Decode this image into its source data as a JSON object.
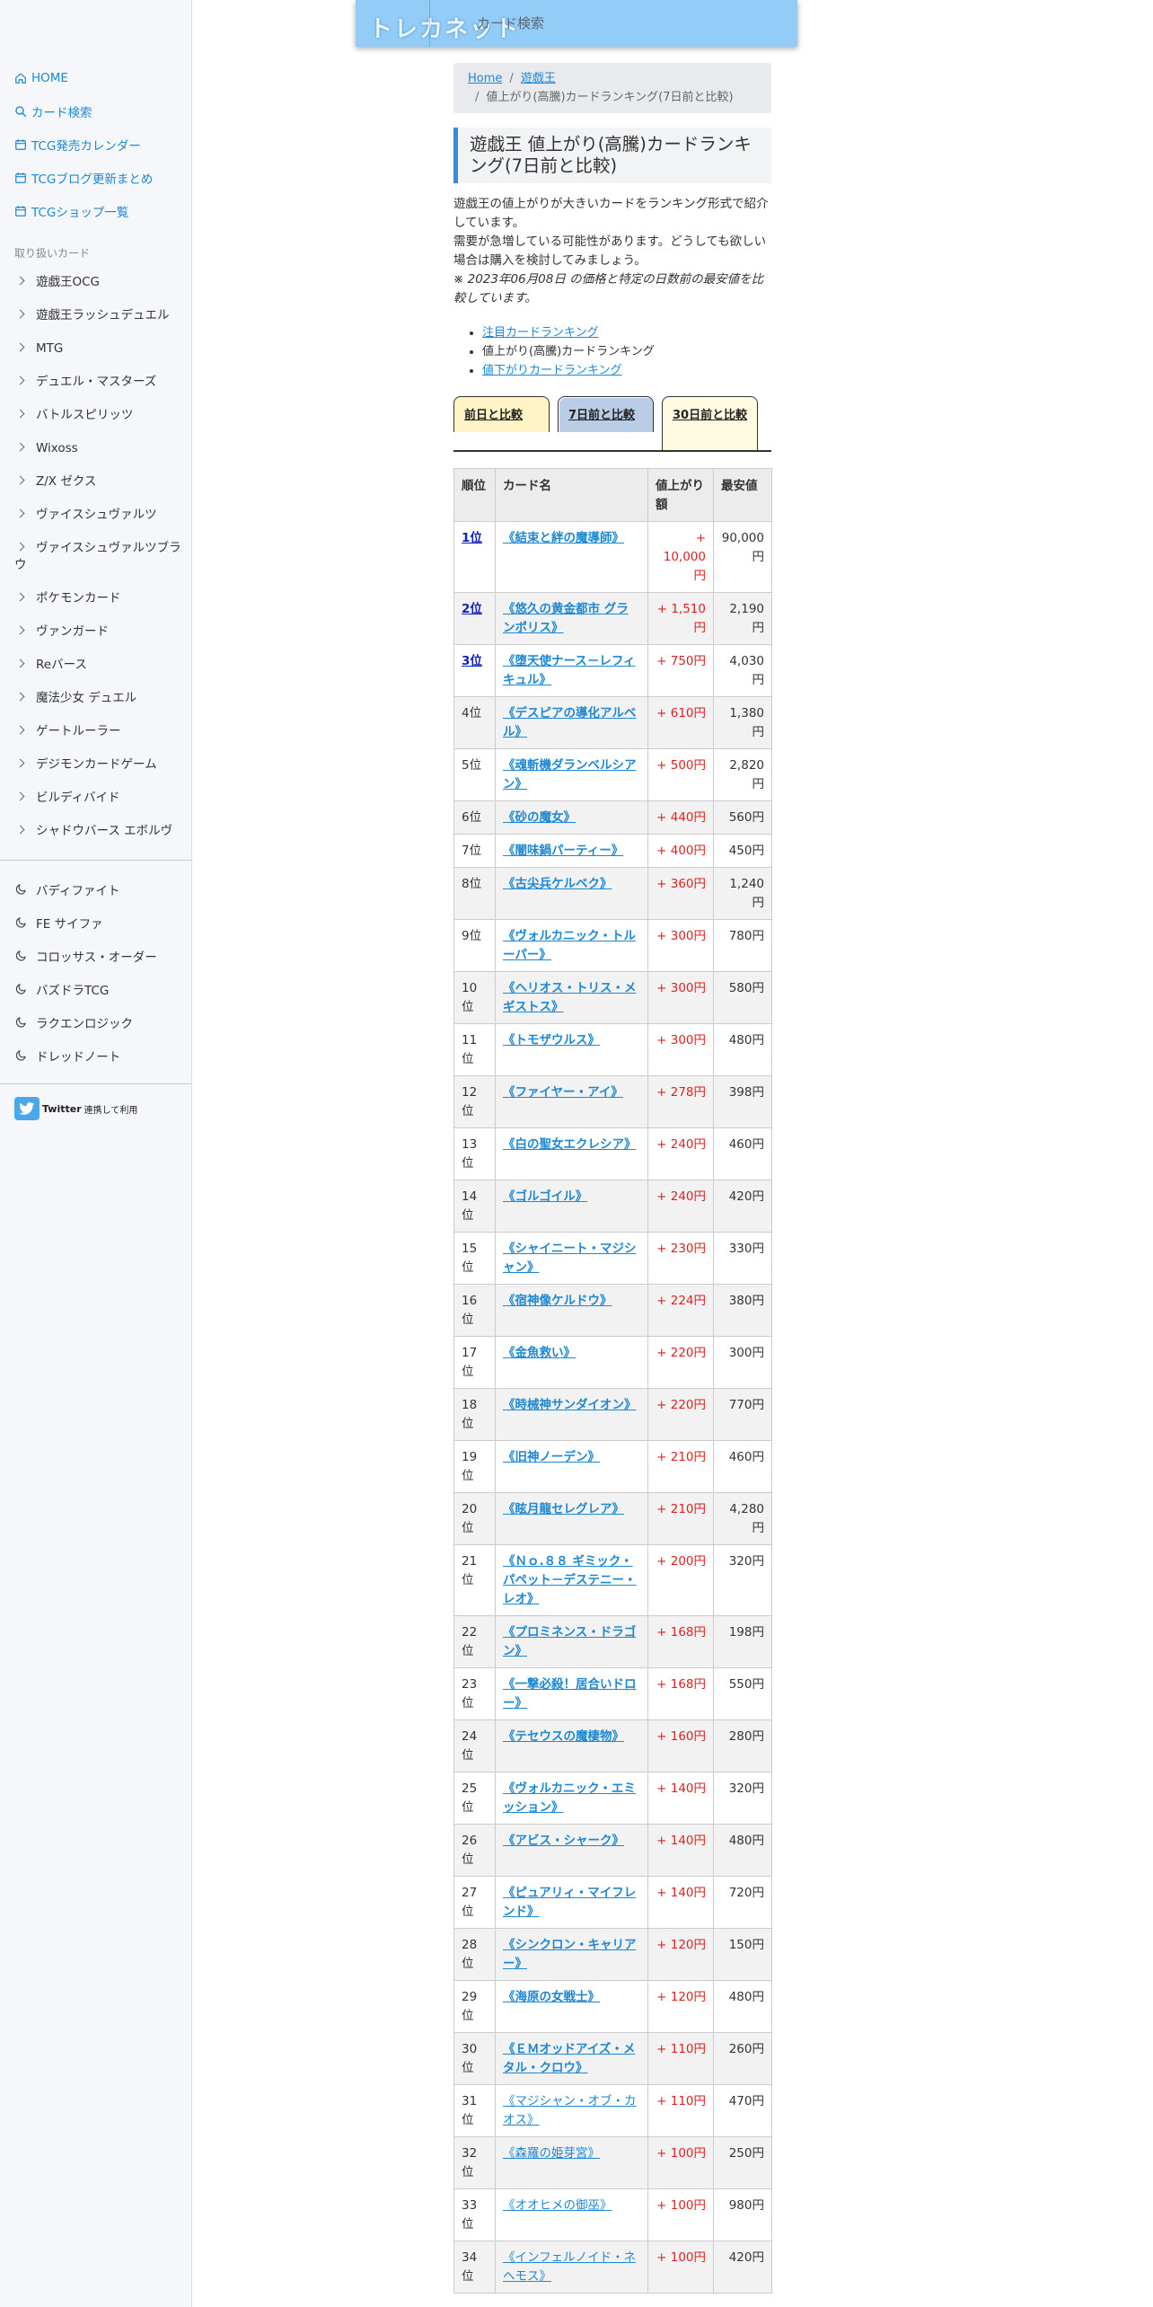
{
  "header": {
    "logo": "トレカネット",
    "search_placeholder": "カード検索"
  },
  "sidebar": {
    "nav": [
      {
        "label": "HOME",
        "icon": "home-icon"
      },
      {
        "label": "カード検索",
        "icon": "search-icon"
      },
      {
        "label": "TCG発売カレンダー",
        "icon": "calendar-icon"
      },
      {
        "label": "TCGブログ更新まとめ",
        "icon": "calendar-icon"
      },
      {
        "label": "TCGショップ一覧",
        "icon": "calendar-icon"
      }
    ],
    "categories_heading": "取り扱いカード",
    "categories": [
      "遊戯王OCG",
      "遊戯王ラッシュデュエル",
      "MTG",
      "デュエル・マスターズ",
      "バトルスピリッツ",
      "Wixoss",
      "Z/X ゼクス",
      "ヴァイスシュヴァルツ",
      "ヴァイスシュヴァルツブラウ",
      "ポケモンカード",
      "ヴァンガード",
      "Reバース",
      "魔法少女 デュエル",
      "ゲートルーラー",
      "デジモンカードゲーム",
      "ビルディバイド",
      "シャドウバース エボルヴ"
    ],
    "others": [
      "バディファイト",
      "FE サイファ",
      "コロッサス・オーダー",
      "バズドラTCG",
      "ラクエンロジック",
      "ドレッドノート"
    ],
    "twitter_label": "Twitter",
    "twitter_suffix": "連携して利用"
  },
  "breadcrumb": {
    "home": "Home",
    "category": "遊戯王",
    "current": "値上がり(高騰)カードランキング(7日前と比較)"
  },
  "title": "遊戯王 値上がり(高騰)カードランキング(7日前と比較)",
  "intro": {
    "line1": "遊戯王の値上がりが大きいカードをランキング形式で紹介しています。",
    "line2": "需要が急増している可能性があります。どうしても欲しい場合は購入を検討してみましょう。",
    "note": "※ 2023年06月08日 の価格と特定の日数前の最安値を比較しています。"
  },
  "ranking_links": [
    {
      "label": "注目カードランキング",
      "link": true
    },
    {
      "label": "値上がり(高騰)カードランキング",
      "link": false
    },
    {
      "label": "値下がりカードランキング",
      "link": true
    }
  ],
  "tabs": [
    "前日と比較",
    "7日前と比較",
    "30日前と比較"
  ],
  "table": {
    "headers": [
      "順位",
      "カード名",
      "値上がり額",
      "最安値"
    ],
    "rows": [
      {
        "rank": "1位",
        "name": "《結束と絆の魔導師》",
        "up": "+ 10,000円",
        "price": "90,000円"
      },
      {
        "rank": "2位",
        "name": "《悠久の黄金都市 グランポリス》",
        "up": "+ 1,510円",
        "price": "2,190円"
      },
      {
        "rank": "3位",
        "name": "《堕天使ナース－レフィキュル》",
        "up": "+ 750円",
        "price": "4,030円"
      },
      {
        "rank": "4位",
        "name": "《デスピアの導化アルベル》",
        "up": "+ 610円",
        "price": "1,380円"
      },
      {
        "rank": "5位",
        "name": "《魂斬機ダランベルシアン》",
        "up": "+ 500円",
        "price": "2,820円"
      },
      {
        "rank": "6位",
        "name": "《砂の魔女》",
        "up": "+ 440円",
        "price": "560円"
      },
      {
        "rank": "7位",
        "name": "《闇味鍋パーティー》",
        "up": "+ 400円",
        "price": "450円"
      },
      {
        "rank": "8位",
        "name": "《古尖兵ケルベク》",
        "up": "+ 360円",
        "price": "1,240円"
      },
      {
        "rank": "9位",
        "name": "《ヴォルカニック・トルーパー》",
        "up": "+ 300円",
        "price": "780円"
      },
      {
        "rank": "10位",
        "name": "《ヘリオス・トリス・メギストス》",
        "up": "+ 300円",
        "price": "580円"
      },
      {
        "rank": "11位",
        "name": "《トモザウルス》",
        "up": "+ 300円",
        "price": "480円"
      },
      {
        "rank": "12位",
        "name": "《ファイヤー・アイ》",
        "up": "+ 278円",
        "price": "398円"
      },
      {
        "rank": "13位",
        "name": "《白の聖女エクレシア》",
        "up": "+ 240円",
        "price": "460円"
      },
      {
        "rank": "14位",
        "name": "《ゴルゴイル》",
        "up": "+ 240円",
        "price": "420円"
      },
      {
        "rank": "15位",
        "name": "《シャイニート・マジシャン》",
        "up": "+ 230円",
        "price": "330円"
      },
      {
        "rank": "16位",
        "name": "《宿神像ケルドウ》",
        "up": "+ 224円",
        "price": "380円"
      },
      {
        "rank": "17位",
        "name": "《金魚救い》",
        "up": "+ 220円",
        "price": "300円"
      },
      {
        "rank": "18位",
        "name": "《時械神サンダイオン》",
        "up": "+ 220円",
        "price": "770円"
      },
      {
        "rank": "19位",
        "name": "《旧神ノーデン》",
        "up": "+ 210円",
        "price": "460円"
      },
      {
        "rank": "20位",
        "name": "《眩月龍セレグレア》",
        "up": "+ 210円",
        "price": "4,280円"
      },
      {
        "rank": "21位",
        "name": "《Ｎｏ.８８ ギミック・パペット－デステニー・レオ》",
        "up": "+ 200円",
        "price": "320円"
      },
      {
        "rank": "22位",
        "name": "《プロミネンス・ドラゴン》",
        "up": "+ 168円",
        "price": "198円"
      },
      {
        "rank": "23位",
        "name": "《一撃必殺！居合いドロー》",
        "up": "+ 168円",
        "price": "550円"
      },
      {
        "rank": "24位",
        "name": "《テセウスの魔棲物》",
        "up": "+ 160円",
        "price": "280円"
      },
      {
        "rank": "25位",
        "name": "《ヴォルカニック・エミッション》",
        "up": "+ 140円",
        "price": "320円"
      },
      {
        "rank": "26位",
        "name": "《アビス・シャーク》",
        "up": "+ 140円",
        "price": "480円"
      },
      {
        "rank": "27位",
        "name": "《ピュアリィ・マイフレンド》",
        "up": "+ 140円",
        "price": "720円"
      },
      {
        "rank": "28位",
        "name": "《シンクロン・キャリアー》",
        "up": "+ 120円",
        "price": "150円"
      },
      {
        "rank": "29位",
        "name": "《海原の女戦士》",
        "up": "+ 120円",
        "price": "480円"
      },
      {
        "rank": "30位",
        "name": "《ＥＭオッドアイズ・メタル・クロウ》",
        "up": "+ 110円",
        "price": "260円"
      },
      {
        "rank": "31位",
        "name": "《マジシャン・オブ・カオス》",
        "up": "+ 110円",
        "price": "470円"
      },
      {
        "rank": "32位",
        "name": "《森羅の姫芽宮》",
        "up": "+ 100円",
        "price": "250円"
      },
      {
        "rank": "33位",
        "name": "《オオヒメの御巫》",
        "up": "+ 100円",
        "price": "980円"
      },
      {
        "rank": "34位",
        "name": "《インフェルノイド・ネヘモス》",
        "up": "+ 100円",
        "price": "420円"
      }
    ]
  },
  "colors": {
    "accent": "#1e88d2",
    "header_bg": "#93cdf7",
    "price_up": "#e02020",
    "top_rank": "#1122bb"
  }
}
